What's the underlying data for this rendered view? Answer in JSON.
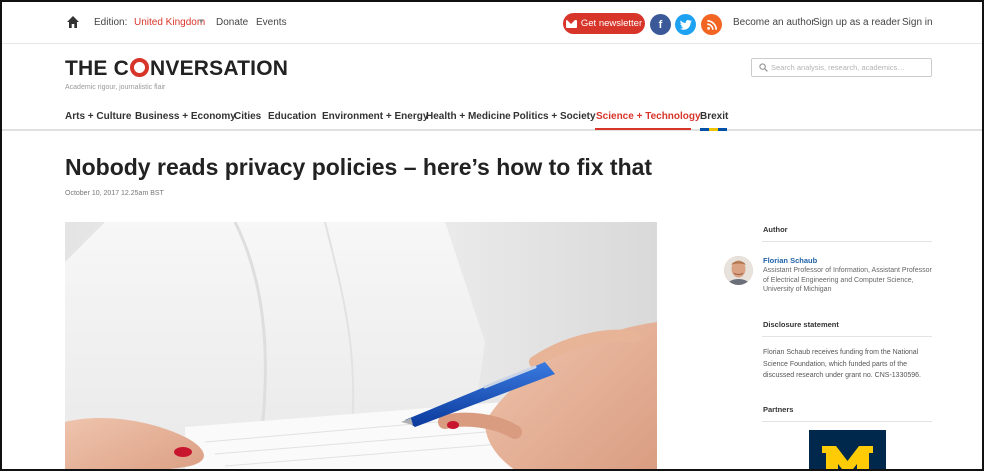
{
  "topbar": {
    "home_icon": "home-icon",
    "edition_label": "Edition:",
    "edition_value": "United Kingdom",
    "caret": "▾",
    "donate": "Donate",
    "events": "Events",
    "newsletter": "Get newsletter",
    "social": {
      "facebook": "f",
      "twitter": "t",
      "rss": "rss"
    },
    "become_author": "Become an author",
    "signup_reader": "Sign up as a reader",
    "signin": "Sign in"
  },
  "masthead": {
    "logo_before": "THE C",
    "logo_after": "NVERSATION",
    "tagline": "Academic rigour, journalistic flair",
    "search_placeholder": "Search analysis, research, academics…"
  },
  "nav": {
    "items": [
      "Arts + Culture",
      "Business + Economy",
      "Cities",
      "Education",
      "Environment + Energy",
      "Health + Medicine",
      "Politics + Society",
      "Science + Technology",
      "Brexit"
    ],
    "active": "Science + Technology"
  },
  "article": {
    "headline": "Nobody reads privacy policies – here’s how to fix that",
    "dateline": "October 10, 2017 12.25am BST"
  },
  "sidebar": {
    "author_heading": "Author",
    "author_name": "Florian Schaub",
    "author_role": "Assistant Professor of Information, Assistant Professor of Electrical Engineering and Computer Science, University of Michigan",
    "disclosure_heading": "Disclosure statement",
    "disclosure_text": "Florian Schaub receives funding from the National Science Foundation, which funded parts of the discussed research under grant no. CNS-1330596.",
    "partners_heading": "Partners",
    "partner_logo_letter": "M"
  },
  "colors": {
    "accent": "#d8352a",
    "link": "#1f61a8",
    "facebook": "#3b5998",
    "twitter": "#1da1f2",
    "rss": "#f26522",
    "umich_blue": "#00274c",
    "umich_maize": "#ffcb05"
  }
}
